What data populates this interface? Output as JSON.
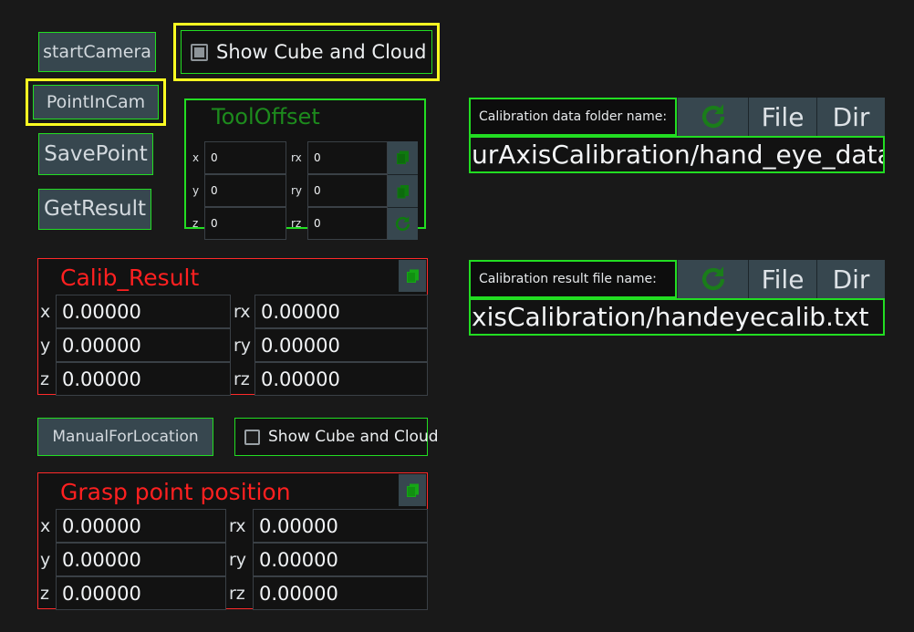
{
  "window": {
    "background_color": "#191919",
    "accent_green": "#22dd22",
    "accent_red": "#ff2a2a",
    "accent_yellow": "#ffff22",
    "button_fill": "#37474f"
  },
  "left_buttons": [
    {
      "label": "startCamera",
      "focused": false
    },
    {
      "label": "PointInCam",
      "focused": true
    },
    {
      "label": "SavePoint",
      "focused": false
    },
    {
      "label": "GetResult",
      "focused": false
    }
  ],
  "top_checkbox": {
    "label": "Show Cube and Cloud",
    "checked": true,
    "focused": true
  },
  "tool_offset": {
    "title": "ToolOffset",
    "rows": [
      {
        "left_label": "x",
        "left_value": "0",
        "right_label": "rx",
        "right_value": "0"
      },
      {
        "left_label": "y",
        "left_value": "0",
        "right_label": "ry",
        "right_value": "0"
      },
      {
        "left_label": "z",
        "left_value": "0",
        "right_label": "rz",
        "right_value": "0"
      }
    ],
    "icons": [
      "copy-icon",
      "copy-icon",
      "refresh-icon"
    ]
  },
  "calib_result": {
    "title": "Calib_Result",
    "copy_icon": "copy-icon",
    "rows": [
      {
        "left_label": "x",
        "left_value": "0.00000",
        "right_label": "rx",
        "right_value": "0.00000"
      },
      {
        "left_label": "y",
        "left_value": "0.00000",
        "right_label": "ry",
        "right_value": "0.00000"
      },
      {
        "left_label": "z",
        "left_value": "0.00000",
        "right_label": "rz",
        "right_value": "0.00000"
      }
    ]
  },
  "manual_row": {
    "button_label": "ManualForLocation",
    "checkbox_label": "Show Cube and Cloud",
    "checkbox_checked": false
  },
  "grasp_point": {
    "title": "Grasp point position",
    "copy_icon": "copy-icon",
    "rows": [
      {
        "left_label": "x",
        "left_value": "0.00000",
        "right_label": "rx",
        "right_value": "0.00000"
      },
      {
        "left_label": "y",
        "left_value": "0.00000",
        "right_label": "ry",
        "right_value": "0.00000"
      },
      {
        "left_label": "z",
        "left_value": "0.00000",
        "right_label": "rz",
        "right_value": "0.00000"
      }
    ]
  },
  "folder_selector": {
    "label": "Calibration data folder name:",
    "refresh_icon": "refresh-icon",
    "file_label": "File",
    "dir_label": "Dir",
    "path_value": "urAxisCalibration/hand_eye_data"
  },
  "result_file_selector": {
    "label": "Calibration result file name:",
    "refresh_icon": "refresh-icon",
    "file_label": "File",
    "dir_label": "Dir",
    "path_value": "xisCalibration/handeyecalib.txt"
  }
}
